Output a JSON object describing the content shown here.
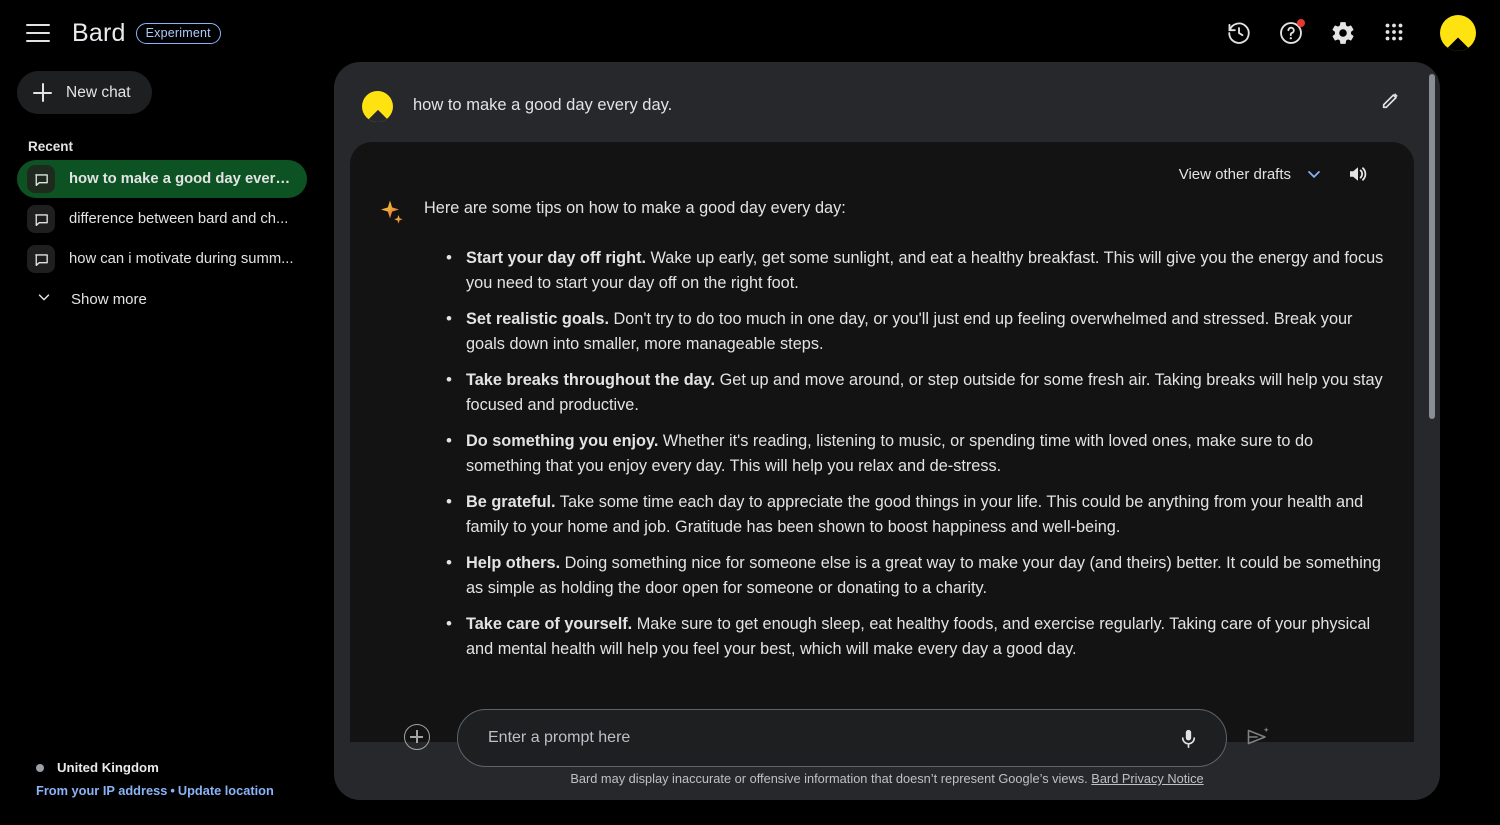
{
  "topbar": {
    "brand": "Bard",
    "badge": "Experiment",
    "icons": {
      "menu": "hamburger-menu-icon",
      "history": "history-icon",
      "help": "help-icon",
      "settings": "gear-icon",
      "apps": "apps-grid-icon",
      "avatar": "user-avatar"
    },
    "notification_color": "#e5392f",
    "avatar_color": "#ffe310"
  },
  "sidebar": {
    "new_chat_label": "New chat",
    "recent_label": "Recent",
    "chats": [
      {
        "title": "how to make a good day every ...",
        "active": true
      },
      {
        "title": "difference between bard and ch...",
        "active": false
      },
      {
        "title": "how can i motivate during summ...",
        "active": false
      }
    ],
    "show_more_label": "Show more",
    "active_color": "#0d5223",
    "location": {
      "country": "United Kingdom",
      "ip_link": "From your IP address",
      "separator": "•",
      "update_link": "Update location",
      "link_color": "#8ab4f8"
    }
  },
  "conversation": {
    "question": "how to make a good day every day.",
    "edit_icon": "pencil-icon",
    "drafts_label": "View other drafts",
    "speaker_icon": "volume-icon",
    "intro": "Here are some tips on how to make a good day every day:",
    "tips": [
      {
        "bold": "Start your day off right.",
        "text": " Wake up early, get some sunlight, and eat a healthy breakfast. This will give you the energy and focus you need to start your day off on the right foot."
      },
      {
        "bold": "Set realistic goals.",
        "text": " Don't try to do too much in one day, or you'll just end up feeling overwhelmed and stressed. Break your goals down into smaller, more manageable steps."
      },
      {
        "bold": "Take breaks throughout the day.",
        "text": " Get up and move around, or step outside for some fresh air. Taking breaks will help you stay focused and productive."
      },
      {
        "bold": "Do something you enjoy.",
        "text": " Whether it's reading, listening to music, or spending time with loved ones, make sure to do something that you enjoy every day. This will help you relax and de-stress."
      },
      {
        "bold": "Be grateful.",
        "text": " Take some time each day to appreciate the good things in your life. This could be anything from your health and family to your home and job. Gratitude has been shown to boost happiness and well-being."
      },
      {
        "bold": "Help others.",
        "text": " Doing something nice for someone else is a great way to make your day (and theirs) better. It could be something as simple as holding the door open for someone or donating to a charity."
      },
      {
        "bold": "Take care of yourself.",
        "text": " Make sure to get enough sleep, eat healthy foods, and exercise regularly. Taking care of your physical and mental health will help you feel your best, which will make every day a good day."
      }
    ]
  },
  "composer": {
    "add_icon": "plus-circle-icon",
    "placeholder": "Enter a prompt here",
    "value": "",
    "mic_icon": "microphone-icon",
    "send_icon": "send-sparkle-icon",
    "disclaimer": "Bard may display inaccurate or offensive information that doesn’t represent Google’s views.",
    "privacy_link": "Bard Privacy Notice"
  }
}
